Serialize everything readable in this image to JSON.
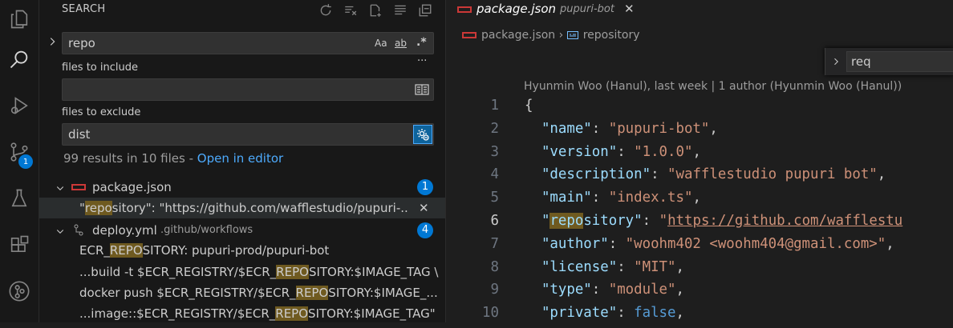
{
  "activity_bar": {
    "scm_badge": "1"
  },
  "search": {
    "title": "SEARCH",
    "query": "repo",
    "match_case": "Aa",
    "whole_word": "ab",
    "regex": ".*",
    "more": "···",
    "include_label": "files to include",
    "include_value": "",
    "exclude_label": "files to exclude",
    "exclude_value": "dist",
    "summary": "99 results in 10 files - ",
    "open_in_editor": "Open in editor",
    "results": [
      {
        "file": "package.json",
        "count": "1",
        "matches": [
          {
            "before": "\"",
            "hit": "repo",
            "after": "sitory\": \"https://github.com/wafflestudio/pupuri-..."
          }
        ]
      },
      {
        "file": "deploy.yml",
        "path": ".github/workflows",
        "count": "4",
        "matches": [
          {
            "before": "ECR_",
            "hit": "REPO",
            "after": "SITORY: pupuri-prod/pupuri-bot"
          },
          {
            "before": "...build -t $ECR_REGISTRY/$ECR_",
            "hit": "REPO",
            "after": "SITORY:$IMAGE_TAG \\"
          },
          {
            "before": "docker push $ECR_REGISTRY/$ECR_",
            "hit": "REPO",
            "after": "SITORY:$IMAGE_..."
          },
          {
            "before": "...image::$ECR_REGISTRY/$ECR_",
            "hit": "REPO",
            "after": "SITORY:$IMAGE_TAG\""
          }
        ]
      }
    ]
  },
  "editor": {
    "tab": {
      "name": "package.json",
      "description": "pupuri-bot",
      "close": "✕"
    },
    "breadcrumb": [
      "package.json",
      "repository"
    ],
    "find_value": "req",
    "blame": "Hyunmin Woo (Hanul), last week | 1 author (Hyunmin Woo (Hanul))",
    "active_line": 6,
    "lines": [
      {
        "num": "1",
        "text": "{"
      },
      {
        "num": "2",
        "key": "name",
        "value": "\"pupuri-bot\""
      },
      {
        "num": "3",
        "key": "version",
        "value": "\"1.0.0\""
      },
      {
        "num": "4",
        "key": "description",
        "value": "\"wafflestudio pupuri bot\""
      },
      {
        "num": "5",
        "key": "main",
        "value": "\"index.ts\""
      },
      {
        "num": "6",
        "key": "repository",
        "value": "\"https://github.com/wafflestu"
      },
      {
        "num": "7",
        "key": "author",
        "value": "\"woohm402 <woohm404@gmail.com>\""
      },
      {
        "num": "8",
        "key": "license",
        "value": "\"MIT\""
      },
      {
        "num": "9",
        "key": "type",
        "value": "\"module\""
      },
      {
        "num": "10",
        "key": "private",
        "value": "false"
      }
    ]
  },
  "colors": {
    "accent": "#0078d4",
    "match_highlight": "#6f5a20",
    "link": "#4daafc"
  }
}
